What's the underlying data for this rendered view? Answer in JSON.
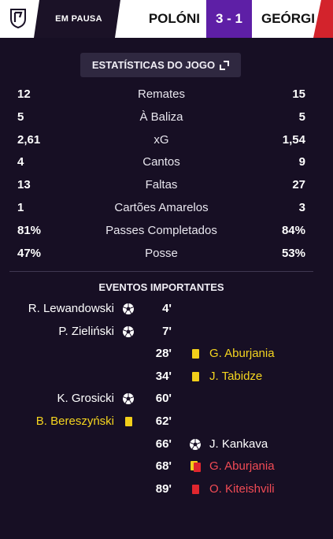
{
  "header": {
    "status": "EM PAUSA",
    "home_team": "POLÓNI",
    "score": "3 - 1",
    "away_team": "GEÓRGI",
    "colors": {
      "score_bg": "#5e1fa6",
      "away_accent": "#d3232c"
    }
  },
  "stats": {
    "title": "ESTATÍSTICAS DO JOGO",
    "expand_icon": "expand-icon",
    "rows": [
      {
        "home": "12",
        "label": "Remates",
        "away": "15"
      },
      {
        "home": "5",
        "label": "À Baliza",
        "away": "5"
      },
      {
        "home": "2,61",
        "label": "xG",
        "away": "1,54"
      },
      {
        "home": "4",
        "label": "Cantos",
        "away": "9"
      },
      {
        "home": "13",
        "label": "Faltas",
        "away": "27"
      },
      {
        "home": "1",
        "label": "Cartões Amarelos",
        "away": "3"
      },
      {
        "home": "81%",
        "label": "Passes Completados",
        "away": "84%"
      },
      {
        "home": "47%",
        "label": "Posse",
        "away": "53%"
      }
    ]
  },
  "events": {
    "title": "EVENTOS IMPORTANTES",
    "items": [
      {
        "minute": "4'",
        "side": "home",
        "type": "goal",
        "player": "R. Lewandowski"
      },
      {
        "minute": "7'",
        "side": "home",
        "type": "goal",
        "player": "P. Zieliński"
      },
      {
        "minute": "28'",
        "side": "away",
        "type": "yellow",
        "player": "G. Aburjania"
      },
      {
        "minute": "34'",
        "side": "away",
        "type": "yellow",
        "player": "J. Tabidze"
      },
      {
        "minute": "60'",
        "side": "home",
        "type": "goal",
        "player": "K. Grosicki"
      },
      {
        "minute": "62'",
        "side": "home",
        "type": "yellow",
        "player": "B. Bereszyński"
      },
      {
        "minute": "66'",
        "side": "away",
        "type": "goal",
        "player": "J. Kankava"
      },
      {
        "minute": "68'",
        "side": "away",
        "type": "second-yellow",
        "player": "G. Aburjania"
      },
      {
        "minute": "89'",
        "side": "away",
        "type": "red",
        "player": "O. Kiteishvili"
      }
    ]
  }
}
